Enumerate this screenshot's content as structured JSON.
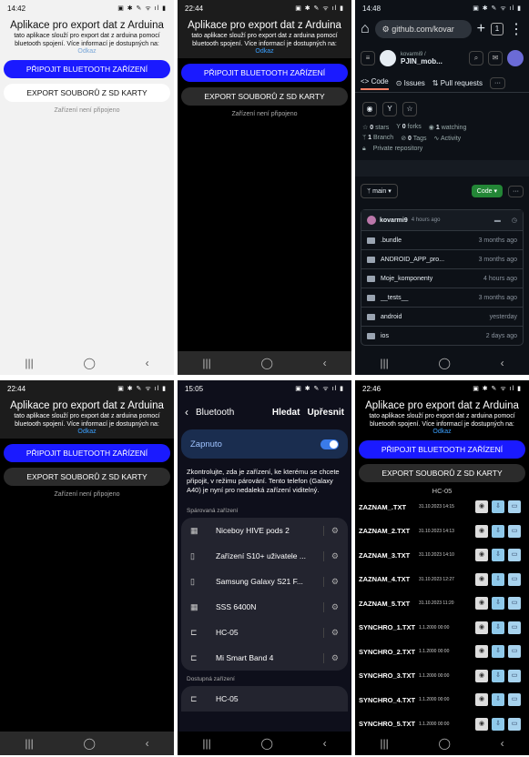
{
  "app": {
    "title": "Aplikace pro export dat z Arduina",
    "description": "tato aplikace slouží pro export dat z arduina pomocí bluetooth spojení. Více informací je dostupných na:",
    "link": "Odkaz",
    "connect_button": "PŘIPOJIT BLUETOOTH ZAŘÍZENÍ",
    "export_button": "EXPORT SOUBORŮ Z SD KARTY",
    "status_disconnected": "Zařízení není připojeno"
  },
  "phone1": {
    "time": "14:42"
  },
  "phone2": {
    "time": "22:44"
  },
  "phone4": {
    "time": "22:44"
  },
  "phone3": {
    "time": "14:48",
    "url": "github.com/kovar",
    "owner": "kovarmi9 /",
    "repo": "PJIN_mob...",
    "tabs": {
      "code": "Code",
      "issues": "Issues",
      "pulls": "Pull requests"
    },
    "stats": {
      "stars_n": "0",
      "stars": "stars",
      "forks_n": "0",
      "forks": "forks",
      "watching_n": "1",
      "watching": "watching"
    },
    "meta": {
      "branch_n": "1",
      "branch": "Branch",
      "tags_n": "0",
      "tags": "Tags",
      "activity": "Activity"
    },
    "private": "Private repository",
    "branch_name": "main",
    "code_button": "Code",
    "commit_author": "kovarmi9",
    "commit_time": "4 hours ago",
    "files": [
      {
        "name": ".bundle",
        "time": "3 months ago"
      },
      {
        "name": "ANDROID_APP_pro...",
        "time": "3 months ago"
      },
      {
        "name": "Moje_komponenty",
        "time": "4 hours ago"
      },
      {
        "name": "__tests__",
        "time": "3 months ago"
      },
      {
        "name": "android",
        "time": "yesterday"
      },
      {
        "name": "ios",
        "time": "2 days ago"
      }
    ]
  },
  "phone5": {
    "time": "15:05",
    "title": "Bluetooth",
    "search": "Hledat",
    "refine": "Upřesnit",
    "toggle_label": "Zapnuto",
    "description": "Zkontrolujte, zda je zařízení, ke kterému se chcete připojit, v režimu párování. Tento telefon (Galaxy A40) je nyní pro nedaleká zařízení viditelný.",
    "paired_title": "Spárovaná zařízení",
    "paired": [
      {
        "name": "Niceboy HIVE pods 2",
        "icon": "earbuds-icon"
      },
      {
        "name": "Zařízení S10+ uživatele ...",
        "icon": "phone-icon"
      },
      {
        "name": "Samsung Galaxy S21 F...",
        "icon": "phone-icon"
      },
      {
        "name": "SSS 6400N",
        "icon": "earbuds-icon"
      },
      {
        "name": "HC-05",
        "icon": "computer-icon"
      },
      {
        "name": "Mi Smart Band 4",
        "icon": "computer-icon"
      }
    ],
    "available_title": "Dostupná zařízení",
    "available": [
      {
        "name": "HC-05",
        "icon": "computer-icon"
      }
    ]
  },
  "phone6": {
    "time": "22:46",
    "device": "HC-05",
    "files": [
      {
        "name": "ZAZNAM_.TXT",
        "date": "31.10.2023 14:15"
      },
      {
        "name": "ZAZNAM_2.TXT",
        "date": "31.10.2023 14:13"
      },
      {
        "name": "ZAZNAM_3.TXT",
        "date": "31.10.2023 14:10"
      },
      {
        "name": "ZAZNAM_4.TXT",
        "date": "31.10.2023 12:27"
      },
      {
        "name": "ZAZNAM_5.TXT",
        "date": "31.10.2023 11:20"
      },
      {
        "name": "SYNCHRO_1.TXT",
        "date": "1.1.2000 00:00"
      },
      {
        "name": "SYNCHRO_2.TXT",
        "date": "1.1.2000 00:00"
      },
      {
        "name": "SYNCHRO_3.TXT",
        "date": "1.1.2000 00:00"
      },
      {
        "name": "SYNCHRO_4.TXT",
        "date": "1.1.2000 00:00"
      },
      {
        "name": "SYNCHRO_5.TXT",
        "date": "1.1.2000 00:00"
      }
    ]
  }
}
